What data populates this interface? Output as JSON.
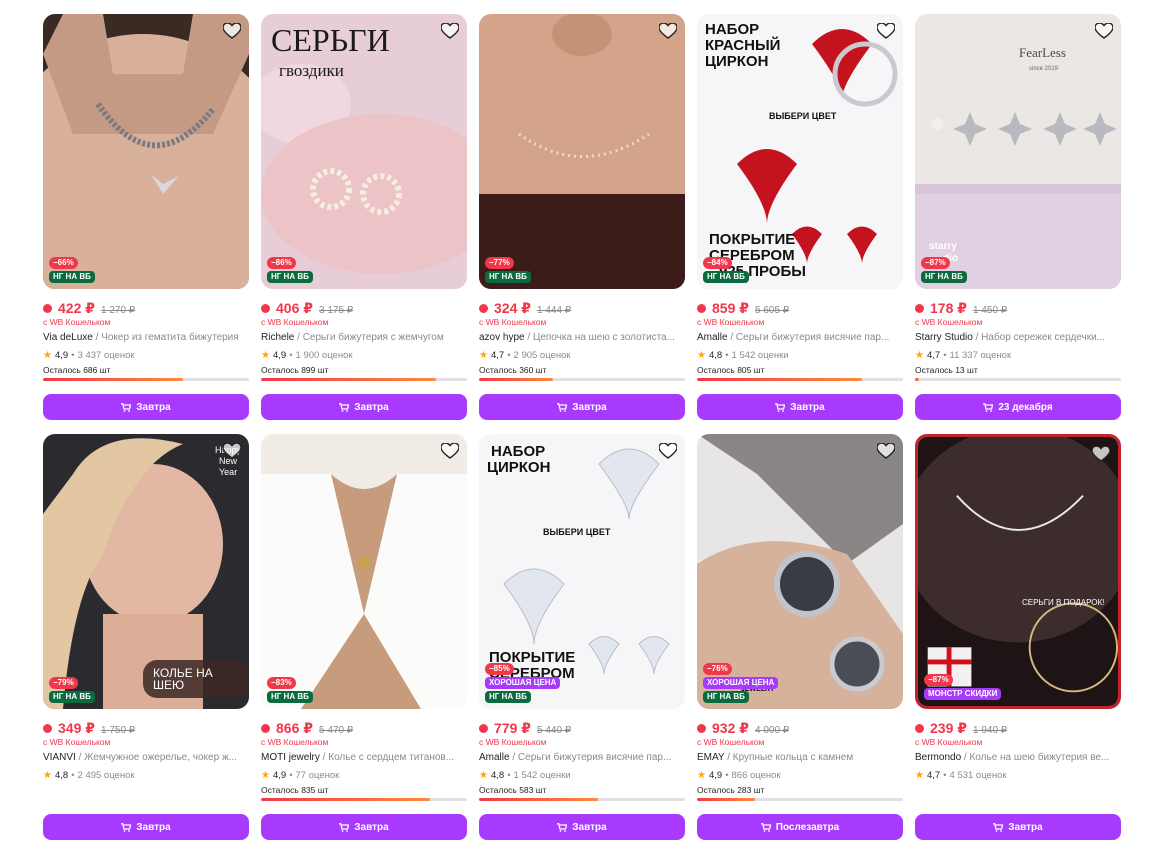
{
  "products": [
    {
      "price": "422 ₽",
      "old_price": "1 270 ₽",
      "wallet": "с WB Кошельком",
      "brand": "Via deLuxe",
      "name": "Чокер из гематита бижутерия",
      "rating": "4,9",
      "reviews": "3 437 оценок",
      "left_text": "Осталось 686 шт",
      "stock_level": 0.68,
      "discount": "−66%",
      "badges": [
        "НГ НА ВБ"
      ],
      "button": "Завтра"
    },
    {
      "price": "406 ₽",
      "old_price": "3 175 ₽",
      "wallet": "с WB Кошельком",
      "brand": "Richele",
      "name": "Серьги бижутерия с жемчугом",
      "rating": "4,9",
      "reviews": "1 900 оценок",
      "left_text": "Осталось 899 шт",
      "stock_level": 0.85,
      "discount": "−86%",
      "badges": [
        "НГ НА ВБ"
      ],
      "button": "Завтра",
      "overlay": [
        "СЕРЬГИ",
        "гвоздики"
      ]
    },
    {
      "price": "324 ₽",
      "old_price": "1 444 ₽",
      "wallet": "с WB Кошельком",
      "brand": "azov hype",
      "name": "Цепочка на шею с золотиста...",
      "rating": "4,7",
      "reviews": "2 905 оценок",
      "left_text": "Осталось 360 шт",
      "stock_level": 0.36,
      "discount": "−77%",
      "badges": [
        "НГ НА ВБ"
      ],
      "button": "Завтра"
    },
    {
      "price": "859 ₽",
      "old_price": "5 605 ₽",
      "wallet": "с WB Кошельком",
      "brand": "Amalle",
      "name": "Серьги бижутерия висячие пар...",
      "rating": "4,8",
      "reviews": "1 542 оценки",
      "left_text": "Осталось 805 шт",
      "stock_level": 0.8,
      "discount": "−84%",
      "badges": [
        "НГ НА ВБ"
      ],
      "button": "Завтра",
      "overlay": [
        "НАБОР",
        "КРАСНЫЙ",
        "ЦИРКОН",
        "ВЫБЕРИ ЦВЕТ",
        "ПОКРЫТИЕ",
        "СЕРЕБРОМ",
        "925 ПРОБЫ"
      ]
    },
    {
      "price": "178 ₽",
      "old_price": "1 450 ₽",
      "wallet": "с WB Кошельком",
      "brand": "Starry Studio",
      "name": "Набор сережек сердечки...",
      "rating": "4,7",
      "reviews": "11 337 оценок",
      "left_text": "Осталось 13 шт",
      "stock_level": 0.02,
      "discount": "−87%",
      "badges": [
        "НГ НА ВБ"
      ],
      "button": "23 декабря",
      "overlay": [
        "FearLess",
        "since 2019",
        "starry",
        "dio"
      ]
    },
    {
      "price": "349 ₽",
      "old_price": "1 750 ₽",
      "wallet": "с WB Кошельком",
      "brand": "VIANVI",
      "name": "Жемчужное ожерелье, чокер ж...",
      "rating": "4,8",
      "reviews": "2 495 оценок",
      "left_text": "",
      "stock_level": null,
      "discount": "−79%",
      "badges": [
        "НГ НА ВБ"
      ],
      "button": "Завтра",
      "overlay": [
        "КОЛЬЕ НА ШЕЮ",
        "Happy",
        "New",
        "Year"
      ]
    },
    {
      "price": "866 ₽",
      "old_price": "5 470 ₽",
      "wallet": "с WB Кошельком",
      "brand": "MOTI jewelry",
      "name": "Колье с сердцем титанов...",
      "rating": "4,9",
      "reviews": "77 оценок",
      "left_text": "Осталось 835 шт",
      "stock_level": 0.82,
      "discount": "−83%",
      "badges": [
        "НГ НА ВБ"
      ],
      "button": "Завтра"
    },
    {
      "price": "779 ₽",
      "old_price": "5 440 ₽",
      "wallet": "с WB Кошельком",
      "brand": "Amalle",
      "name": "Серьги бижутерия висячие пар...",
      "rating": "4,8",
      "reviews": "1 542 оценки",
      "left_text": "Осталось 583 шт",
      "stock_level": 0.58,
      "discount": "−85%",
      "badges": [
        "ХОРОШАЯ ЦЕНА",
        "НГ НА ВБ"
      ],
      "button": "Завтра",
      "overlay": [
        "НАБОР",
        "ЦИРКОН",
        "ВЫБЕРИ ЦВЕТ",
        "ПОКРЫТИЕ",
        "СЕРЕБРОМ"
      ]
    },
    {
      "price": "932 ₽",
      "old_price": "4 000 ₽",
      "wallet": "с WB Кошельком",
      "brand": "EMAY",
      "name": "Крупные кольца с камнем",
      "rating": "4,9",
      "reviews": "866 оценок",
      "left_text": "Осталось 283 шт",
      "stock_level": 0.28,
      "discount": "−76%",
      "badges": [
        "ХОРОШАЯ ЦЕНА",
        "НГ НА ВБ"
      ],
      "button": "Послезавтра",
      "overlay": [
        "JEWELRY"
      ]
    },
    {
      "price": "239 ₽",
      "old_price": "1 940 ₽",
      "wallet": "с WB Кошельком",
      "brand": "Bermondo",
      "name": "Колье на шею бижутерия ве...",
      "rating": "4,7",
      "reviews": "4 531 оценок",
      "left_text": "",
      "stock_level": null,
      "discount": "−87%",
      "badges": [
        "МОНСТР СКИДКИ"
      ],
      "button": "Завтра",
      "overlay": [
        "СЕРЬГИ В ПОДАРОК!"
      ]
    }
  ],
  "colors": {
    "accent": "#a73afd",
    "price": "#f0384a",
    "ng_badge": "#0c6b3e",
    "star": "#ffa600"
  }
}
